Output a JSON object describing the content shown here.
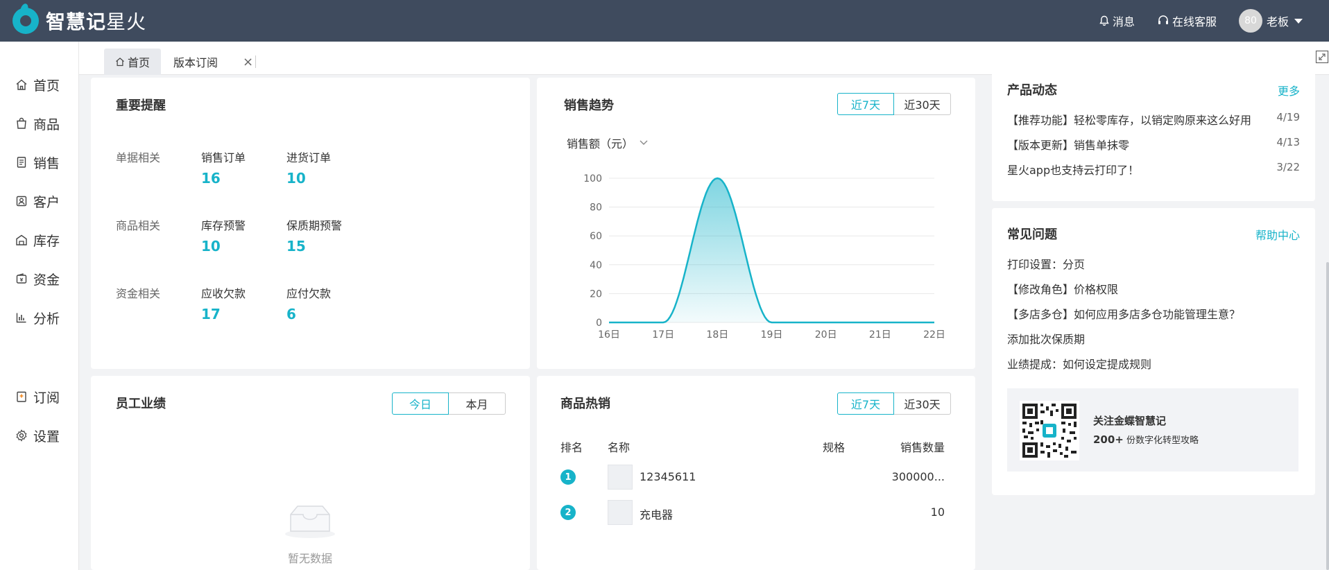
{
  "app": {
    "logo_main": "智慧记",
    "logo_sub": "星火"
  },
  "topbar": {
    "messages": "消息",
    "support": "在线客服",
    "avatar_text": "80",
    "user": "老板"
  },
  "sidebar": {
    "items": [
      {
        "label": "首页",
        "icon": "home-icon"
      },
      {
        "label": "商品",
        "icon": "bag-icon"
      },
      {
        "label": "销售",
        "icon": "document-icon"
      },
      {
        "label": "客户",
        "icon": "contact-icon"
      },
      {
        "label": "库存",
        "icon": "warehouse-icon"
      },
      {
        "label": "资金",
        "icon": "wallet-icon"
      },
      {
        "label": "分析",
        "icon": "bar-chart-icon"
      },
      {
        "label": "订阅",
        "icon": "subscribe-icon"
      },
      {
        "label": "设置",
        "icon": "gear-icon"
      }
    ]
  },
  "tabs": {
    "home": "首页",
    "subscription": "版本订阅",
    "close": "×"
  },
  "reminders": {
    "title": "重要提醒",
    "groups": [
      {
        "label": "单据相关",
        "items": [
          {
            "name": "销售订单",
            "value": "16"
          },
          {
            "name": "进货订单",
            "value": "10"
          }
        ]
      },
      {
        "label": "商品相关",
        "items": [
          {
            "name": "库存预警",
            "value": "10"
          },
          {
            "name": "保质期预警",
            "value": "15"
          }
        ]
      },
      {
        "label": "资金相关",
        "items": [
          {
            "name": "应收欠款",
            "value": "17"
          },
          {
            "name": "应付欠款",
            "value": "6"
          }
        ]
      }
    ]
  },
  "sales_trend": {
    "title": "销售趋势",
    "range_7": "近7天",
    "range_30": "近30天",
    "metric": "销售额（元）"
  },
  "chart_data": {
    "type": "area",
    "title": "",
    "xlabel": "",
    "ylabel": "",
    "x": [
      "16日",
      "17日",
      "18日",
      "19日",
      "20日",
      "21日",
      "22日"
    ],
    "series": [
      {
        "values": [
          0,
          0,
          100,
          0,
          0,
          0,
          0
        ]
      }
    ],
    "ylim": [
      0,
      100
    ],
    "yticks": [
      0,
      20,
      40,
      60,
      80,
      100
    ],
    "grid": true,
    "color": "#17b3c9"
  },
  "news": {
    "title": "产品动态",
    "more": "更多",
    "items": [
      {
        "text": "【推荐功能】轻松零库存，以销定购原来这么好用",
        "date": "4/19"
      },
      {
        "text": "【版本更新】销售单抹零",
        "date": "4/13"
      },
      {
        "text": "星火app也支持云打印了！",
        "date": "3/22"
      }
    ]
  },
  "faq": {
    "title": "常见问题",
    "help": "帮助中心",
    "items": [
      "打印设置：分页",
      "【修改角色】价格权限",
      "【多店多仓】如何应用多店多仓功能管理生意？",
      "添加批次保质期",
      "业绩提成：如何设定提成规则"
    ],
    "qr_title": "关注金蝶智慧记",
    "qr_count": "200+",
    "qr_desc": "份数字化转型攻略"
  },
  "staff": {
    "title": "员工业绩",
    "today": "今日",
    "month": "本月",
    "empty": "暂无数据"
  },
  "hot": {
    "title": "商品热销",
    "range_7": "近7天",
    "range_30": "近30天",
    "columns": {
      "rank": "排名",
      "name": "名称",
      "spec": "规格",
      "qty": "销售数量"
    },
    "rows": [
      {
        "rank": "1",
        "name": "12345611",
        "spec": "",
        "qty": "300000..."
      },
      {
        "rank": "2",
        "name": "充电器",
        "spec": "",
        "qty": "10"
      }
    ]
  },
  "colors": {
    "accent": "#17b3c9",
    "topbar": "#3f4b5e"
  }
}
